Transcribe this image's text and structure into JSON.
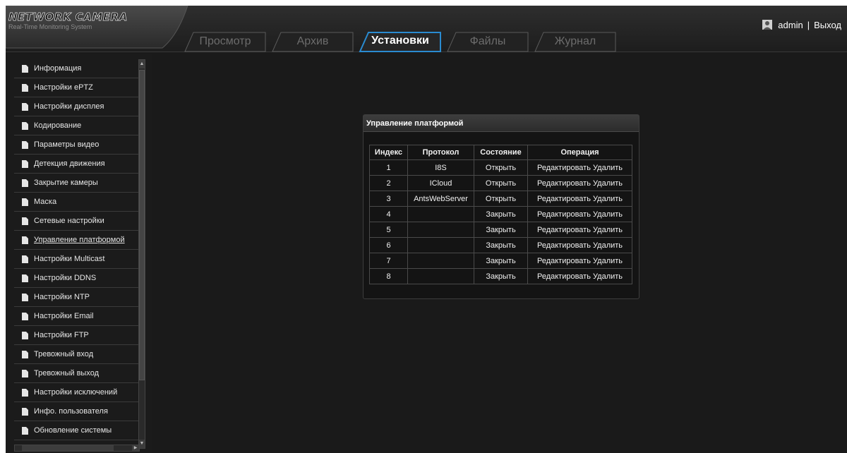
{
  "logo": {
    "title": "NETWORK CAMERA",
    "subtitle": "Real-Time Monitoring System"
  },
  "tabs": [
    {
      "label": "Просмотр"
    },
    {
      "label": "Архив"
    },
    {
      "label": "Установки"
    },
    {
      "label": "Файлы"
    },
    {
      "label": "Журнал"
    }
  ],
  "active_tab": "Установки",
  "user": {
    "name": "admin",
    "separator": "|",
    "logout": "Выход"
  },
  "sidebar": {
    "items": [
      {
        "label": "Информация"
      },
      {
        "label": "Настройки ePTZ"
      },
      {
        "label": "Настройки дисплея"
      },
      {
        "label": "Кодирование"
      },
      {
        "label": "Параметры видео"
      },
      {
        "label": "Детекция движения"
      },
      {
        "label": "Закрытие камеры"
      },
      {
        "label": "Маска"
      },
      {
        "label": "Сетевые настройки"
      },
      {
        "label": "Управление платформой"
      },
      {
        "label": "Настройки Multicast"
      },
      {
        "label": "Настройки DDNS"
      },
      {
        "label": "Настройки NTP"
      },
      {
        "label": "Настройки Email"
      },
      {
        "label": "Настройки FTP"
      },
      {
        "label": "Тревожный вход"
      },
      {
        "label": "Тревожный выход"
      },
      {
        "label": "Настройки исключений"
      },
      {
        "label": "Инфо. пользователя"
      },
      {
        "label": "Обновление системы"
      }
    ],
    "active_item": "Управление платформой"
  },
  "panel": {
    "title": "Управление платформой",
    "columns": [
      "Индекс",
      "Протокол",
      "Состояние",
      "Операция"
    ],
    "edit_label": "Редактировать",
    "delete_label": "Удалить",
    "rows": [
      {
        "index": "1",
        "protocol": "I8S",
        "state": "Открыть"
      },
      {
        "index": "2",
        "protocol": "ICloud",
        "state": "Открыть"
      },
      {
        "index": "3",
        "protocol": "AntsWebServer",
        "state": "Открыть"
      },
      {
        "index": "4",
        "protocol": "",
        "state": "Закрыть"
      },
      {
        "index": "5",
        "protocol": "",
        "state": "Закрыть"
      },
      {
        "index": "6",
        "protocol": "",
        "state": "Закрыть"
      },
      {
        "index": "7",
        "protocol": "",
        "state": "Закрыть"
      },
      {
        "index": "8",
        "protocol": "",
        "state": "Закрыть"
      }
    ]
  },
  "colors": {
    "background": "#1a1a1a",
    "tab_inactive_text": "#6c6c6c",
    "tab_active_accent": "#2a8bd0",
    "panel_background": "#141414",
    "border": "#4a4a4a"
  },
  "icons": {
    "user": "user-icon",
    "menu_item": "document-icon"
  }
}
